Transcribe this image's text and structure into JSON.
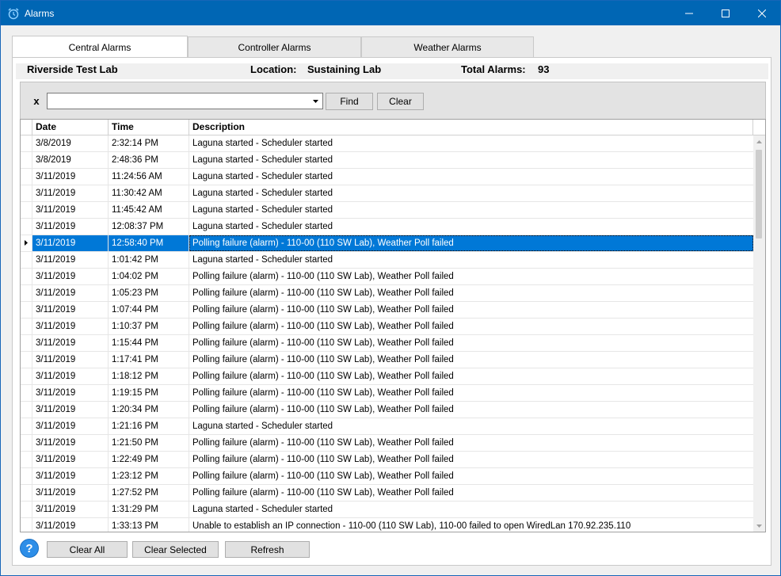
{
  "window": {
    "title": "Alarms",
    "icon": "alarm-clock-icon",
    "controls": {
      "minimize": "minimize-icon",
      "maximize": "maximize-icon",
      "close": "close-icon"
    }
  },
  "tabs": [
    {
      "label": "Central Alarms",
      "active": true
    },
    {
      "label": "Controller Alarms",
      "active": false
    },
    {
      "label": "Weather Alarms",
      "active": false
    }
  ],
  "info": {
    "site": "Riverside Test Lab",
    "location_label": "Location:",
    "location_value": "Sustaining Lab",
    "total_label": "Total Alarms:",
    "total_value": "93"
  },
  "search": {
    "clear_glyph": "x",
    "value": "",
    "find_label": "Find",
    "clear_label": "Clear"
  },
  "grid": {
    "columns": [
      "Date",
      "Time",
      "Description"
    ],
    "selected_index": 6,
    "rows": [
      {
        "date": "3/8/2019",
        "time": "2:32:14 PM",
        "desc": "Laguna started - Scheduler started"
      },
      {
        "date": "3/8/2019",
        "time": "2:48:36 PM",
        "desc": "Laguna started - Scheduler started"
      },
      {
        "date": "3/11/2019",
        "time": "11:24:56 AM",
        "desc": "Laguna started - Scheduler started"
      },
      {
        "date": "3/11/2019",
        "time": "11:30:42 AM",
        "desc": "Laguna started - Scheduler started"
      },
      {
        "date": "3/11/2019",
        "time": "11:45:42 AM",
        "desc": "Laguna started - Scheduler started"
      },
      {
        "date": "3/11/2019",
        "time": "12:08:37 PM",
        "desc": "Laguna started - Scheduler started"
      },
      {
        "date": "3/11/2019",
        "time": "12:58:40 PM",
        "desc": "Polling failure (alarm) - 110-00 (110 SW Lab), Weather Poll failed"
      },
      {
        "date": "3/11/2019",
        "time": "1:01:42 PM",
        "desc": "Laguna started - Scheduler started"
      },
      {
        "date": "3/11/2019",
        "time": "1:04:02 PM",
        "desc": "Polling failure (alarm) - 110-00 (110 SW Lab), Weather Poll failed"
      },
      {
        "date": "3/11/2019",
        "time": "1:05:23 PM",
        "desc": "Polling failure (alarm) - 110-00 (110 SW Lab), Weather Poll failed"
      },
      {
        "date": "3/11/2019",
        "time": "1:07:44 PM",
        "desc": "Polling failure (alarm) - 110-00 (110 SW Lab), Weather Poll failed"
      },
      {
        "date": "3/11/2019",
        "time": "1:10:37 PM",
        "desc": "Polling failure (alarm) - 110-00 (110 SW Lab), Weather Poll failed"
      },
      {
        "date": "3/11/2019",
        "time": "1:15:44 PM",
        "desc": "Polling failure (alarm) - 110-00 (110 SW Lab), Weather Poll failed"
      },
      {
        "date": "3/11/2019",
        "time": "1:17:41 PM",
        "desc": "Polling failure (alarm) - 110-00 (110 SW Lab), Weather Poll failed"
      },
      {
        "date": "3/11/2019",
        "time": "1:18:12 PM",
        "desc": "Polling failure (alarm) - 110-00 (110 SW Lab), Weather Poll failed"
      },
      {
        "date": "3/11/2019",
        "time": "1:19:15 PM",
        "desc": "Polling failure (alarm) - 110-00 (110 SW Lab), Weather Poll failed"
      },
      {
        "date": "3/11/2019",
        "time": "1:20:34 PM",
        "desc": "Polling failure (alarm) - 110-00 (110 SW Lab), Weather Poll failed"
      },
      {
        "date": "3/11/2019",
        "time": "1:21:16 PM",
        "desc": "Laguna started - Scheduler started"
      },
      {
        "date": "3/11/2019",
        "time": "1:21:50 PM",
        "desc": "Polling failure (alarm) - 110-00 (110 SW Lab), Weather Poll failed"
      },
      {
        "date": "3/11/2019",
        "time": "1:22:49 PM",
        "desc": "Polling failure (alarm) - 110-00 (110 SW Lab), Weather Poll failed"
      },
      {
        "date": "3/11/2019",
        "time": "1:23:12 PM",
        "desc": "Polling failure (alarm) - 110-00 (110 SW Lab), Weather Poll failed"
      },
      {
        "date": "3/11/2019",
        "time": "1:27:52 PM",
        "desc": "Polling failure (alarm) - 110-00 (110 SW Lab), Weather Poll failed"
      },
      {
        "date": "3/11/2019",
        "time": "1:31:29 PM",
        "desc": "Laguna started - Scheduler started"
      },
      {
        "date": "3/11/2019",
        "time": "1:33:13 PM",
        "desc": "Unable to establish an IP connection - 110-00 (110 SW Lab), 110-00 failed to open WiredLan 170.92.235.110"
      }
    ]
  },
  "footer": {
    "help_glyph": "?",
    "clear_all_label": "Clear All",
    "clear_selected_label": "Clear Selected",
    "refresh_label": "Refresh"
  },
  "colors": {
    "titlebar": "#0066b4",
    "selection": "#0078d7",
    "help": "#2d8ee8"
  }
}
